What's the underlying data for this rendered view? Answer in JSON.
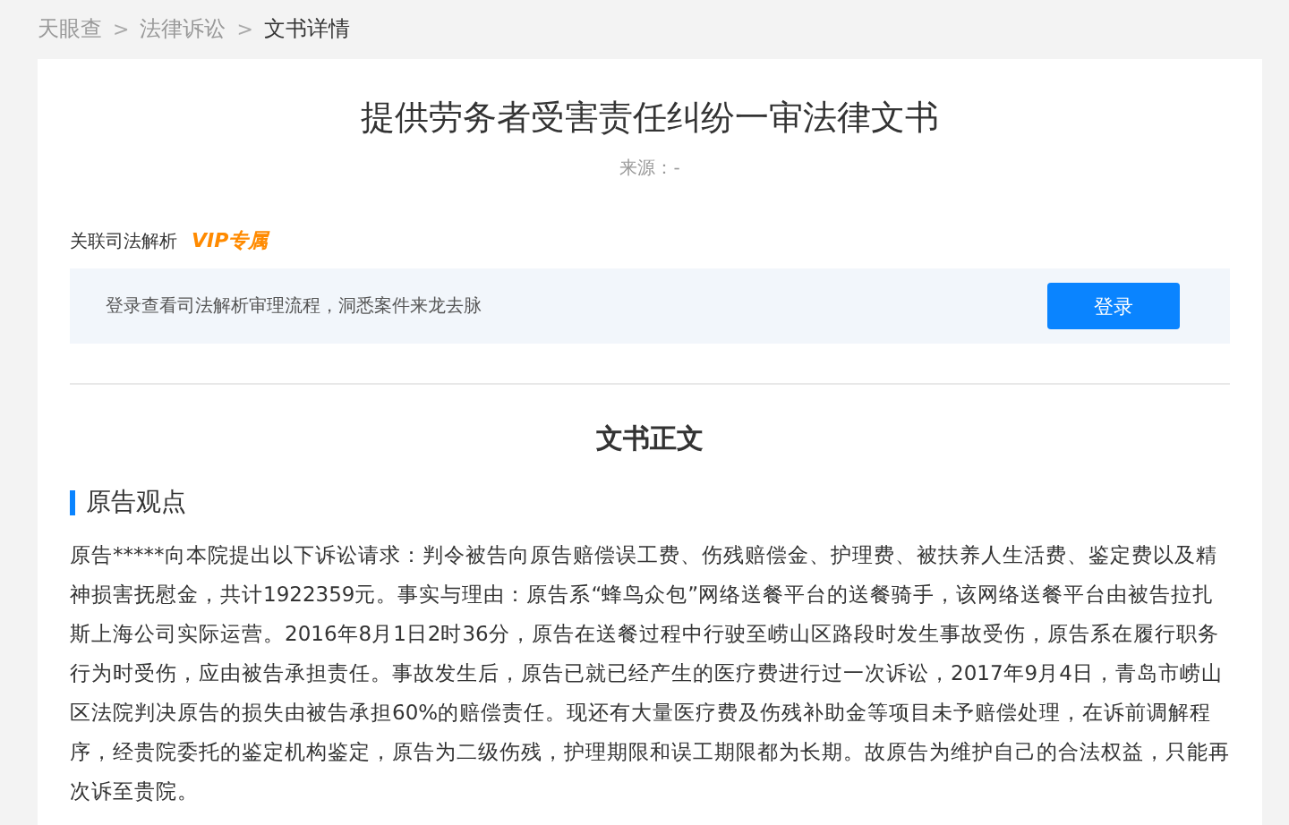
{
  "breadcrumb": [
    {
      "label": "天眼查",
      "current": false
    },
    {
      "label": "法律诉讼",
      "current": false
    },
    {
      "label": "文书详情",
      "current": true
    }
  ],
  "breadcrumb_separator": ">",
  "document": {
    "title": "提供劳务者受害责任纠纷一审法律文书",
    "source": "来源：-"
  },
  "judicial_analysis": {
    "label": "关联司法解析",
    "badge": "VIP专属",
    "prompt": "登录查看司法解析审理流程，洞悉案件来龙去脉",
    "button": "登录"
  },
  "body": {
    "heading": "文书正文",
    "section_title": "原告观点",
    "paragraph": "原告*****向本院提出以下诉讼请求：判令被告向原告赔偿误工费、伤残赔偿金、护理费、被扶养人生活费、鉴定费以及精神损害抚慰金，共计1922359元。事实与理由：原告系“蜂鸟众包”网络送餐平台的送餐骑手，该网络送餐平台由被告拉扎斯上海公司实际运营。2016年8月1日2时36分，原告在送餐过程中行驶至崂山区路段时发生事故受伤，原告系在履行职务行为时受伤，应由被告承担责任。事故发生后，原告已就已经产生的医疗费进行过一次诉讼，2017年9月4日，青岛市崂山区法院判决原告的损失由被告承担60%的赔偿责任。现还有大量医疗费及伤残补助金等项目未予赔偿处理，在诉前调解程序，经贵院委托的鉴定机构鉴定，原告为二级伤残，护理期限和误工期限都为长期。故原告为维护自己的合法权益，只能再次诉至贵院。"
  }
}
